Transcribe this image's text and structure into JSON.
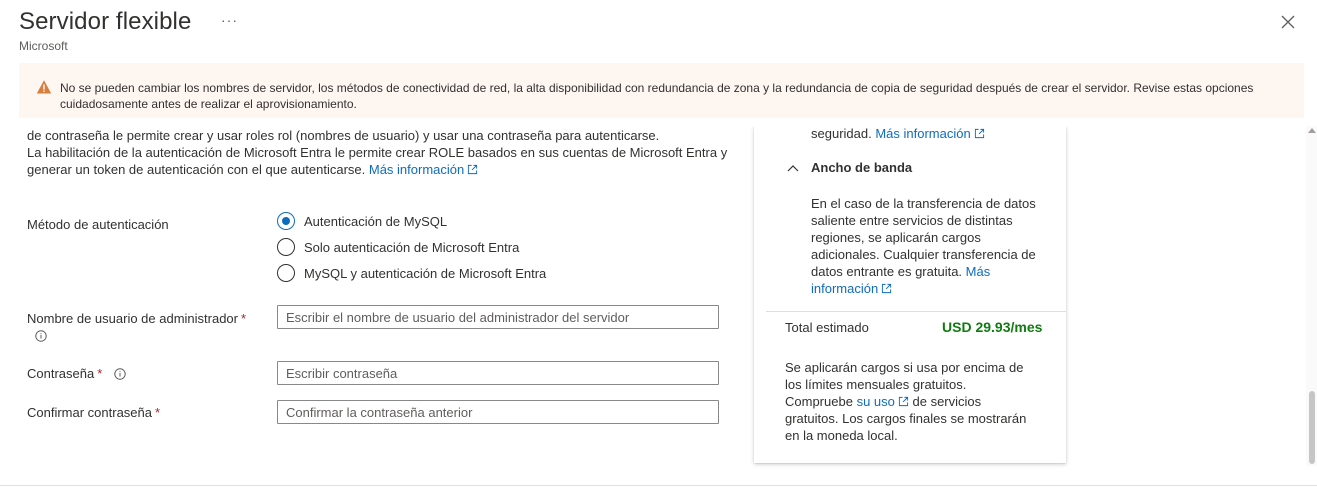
{
  "header": {
    "title": "Servidor flexible",
    "subtitle": "Microsoft",
    "more": "···"
  },
  "warning": {
    "icon": "warning-icon",
    "text": "No se pueden cambiar los nombres de servidor, los métodos de conectividad de red, la alta disponibilidad con redundancia de zona y la redundancia de copia de seguridad después de crear el servidor. Revise estas opciones cuidadosamente antes de realizar el aprovisionamiento."
  },
  "description": {
    "line1": "de contraseña le permite crear y usar roles rol (nombres de usuario) y usar una contraseña para autenticarse.",
    "line2": "La habilitación de la autenticación de Microsoft Entra le permite crear ROLE basados en sus cuentas de Microsoft Entra y generar un token de autenticación con el que autenticarse.",
    "link": "Más información"
  },
  "auth": {
    "label": "Método de autenticación",
    "options": [
      {
        "label": "Autenticación de MySQL",
        "selected": true
      },
      {
        "label": "Solo autenticación de Microsoft Entra",
        "selected": false
      },
      {
        "label": "MySQL y autenticación de Microsoft Entra",
        "selected": false
      }
    ]
  },
  "fields": {
    "admin_label": "Nombre de usuario de administrador",
    "admin_placeholder": "Escribir el nombre de usuario del administrador del servidor",
    "password_label": "Contraseña",
    "password_placeholder": "Escribir contraseña",
    "confirm_label": "Confirmar contraseña",
    "confirm_placeholder": "Confirmar la contraseña anterior",
    "required_mark": "*"
  },
  "summary": {
    "top_text": "seguridad.",
    "top_link": "Más información",
    "bandwidth_heading": "Ancho de banda",
    "bandwidth_text": "En el caso de la transferencia de datos saliente entre servicios de distintas regiones, se aplicarán cargos adicionales. Cualquier transferencia de datos entrante es gratuita.",
    "bandwidth_link": "Más información",
    "total_label": "Total estimado",
    "total_value": "USD 29.93/mes",
    "footer_text1": "Se aplicarán cargos si usa por encima de los límites mensuales gratuitos. Compruebe",
    "footer_link": "su uso",
    "footer_text2": "de servicios gratuitos. Los cargos finales se mostrarán en la moneda local."
  },
  "colors": {
    "accent": "#0f6cbd",
    "warning_bg": "#fdf6f1",
    "warning_icon": "#d67f3c",
    "total_green": "#107c10",
    "required_red": "#a4262c"
  }
}
